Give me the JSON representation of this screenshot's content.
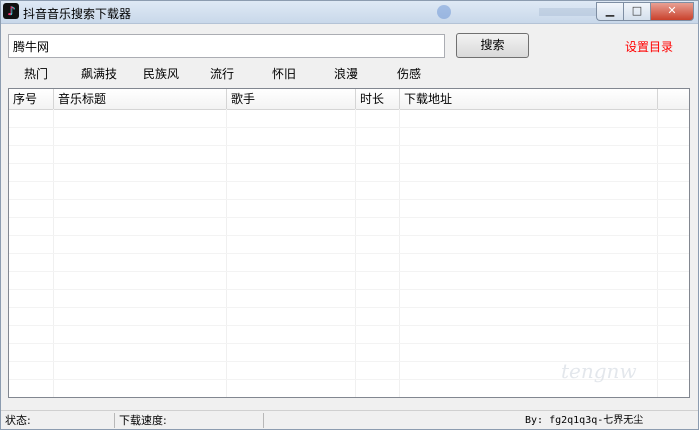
{
  "window": {
    "title": "抖音音乐搜索下载器"
  },
  "search": {
    "value": "腾牛网",
    "button_label": "搜索",
    "settings_label": "设置目录"
  },
  "categories": [
    "热门",
    "飙满技",
    "民族风",
    "流行",
    "怀旧",
    "浪漫",
    "伤感"
  ],
  "table": {
    "columns": [
      "序号",
      "音乐标题",
      "歌手",
      "时长",
      "下载地址"
    ]
  },
  "status": {
    "state_label": "状态:",
    "speed_label": "下载速度:",
    "author": "By: fg2q1q3q-七界无尘"
  },
  "watermark": "tengnw"
}
